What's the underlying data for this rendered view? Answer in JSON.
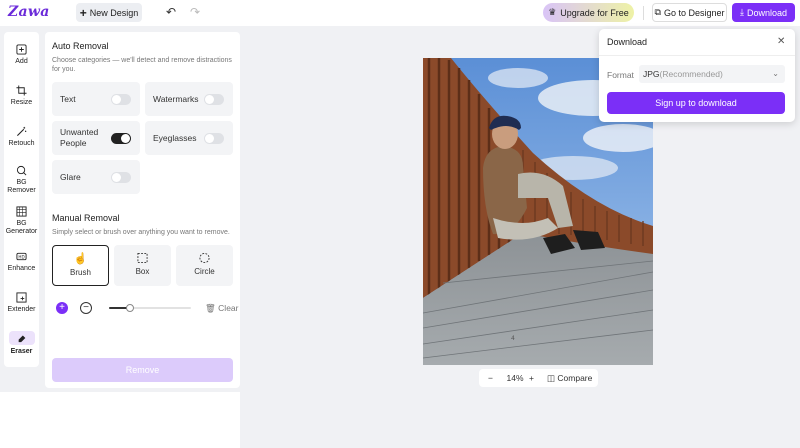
{
  "app": {
    "logo_text": "Zawa",
    "new_design_label": "New Design",
    "upgrade_label": "Upgrade for Free",
    "go_designer_label": "Go to Designer",
    "download_label": "Download",
    "accent_color": "#7b2ff7"
  },
  "nav": {
    "items": [
      {
        "label": "Add",
        "icon": "add-square-icon"
      },
      {
        "label": "Resize",
        "icon": "crop-icon"
      },
      {
        "label": "Retouch",
        "icon": "magic-wand-icon"
      },
      {
        "label": "BG Remover",
        "icon": "bg-remover-icon"
      },
      {
        "label": "BG Generator",
        "icon": "bg-generator-icon"
      },
      {
        "label": "Enhance",
        "icon": "hd-icon"
      },
      {
        "label": "Extender",
        "icon": "extend-icon"
      },
      {
        "label": "Eraser",
        "icon": "eraser-icon",
        "active": true
      }
    ]
  },
  "auto_removal": {
    "title": "Auto Removal",
    "description": "Choose categories — we'll detect and remove distractions for you.",
    "options": [
      {
        "label": "Text",
        "on": false
      },
      {
        "label": "Watermarks",
        "on": false
      },
      {
        "label": "Unwanted People",
        "on": true
      },
      {
        "label": "Eyeglasses",
        "on": false
      },
      {
        "label": "Glare",
        "on": false
      }
    ]
  },
  "manual_removal": {
    "title": "Manual Removal",
    "description": "Simply select or brush over anything you want to remove.",
    "tools": [
      {
        "label": "Brush",
        "selected": true
      },
      {
        "label": "Box",
        "selected": false
      },
      {
        "label": "Circle",
        "selected": false
      }
    ],
    "brush_size_fraction": 0.25,
    "clear_label": "Clear",
    "remove_label": "Remove"
  },
  "canvas": {
    "zoom": "14%",
    "compare_label": "Compare"
  },
  "download_panel": {
    "title": "Download",
    "format_label": "Format",
    "format_value": "JPG",
    "format_note": "(Recommended)",
    "signup_label": "Sign up to download"
  }
}
